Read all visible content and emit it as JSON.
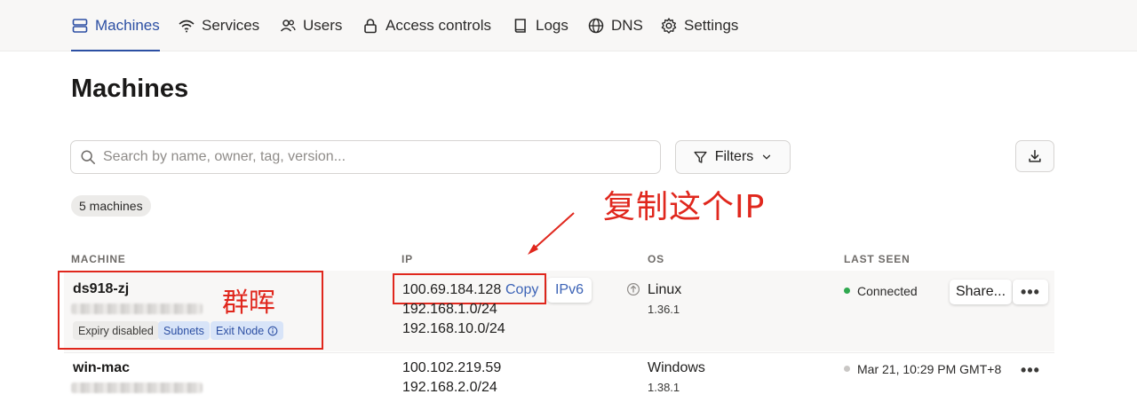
{
  "nav": {
    "items": [
      {
        "label": "Machines",
        "icon": "server-icon",
        "active": true
      },
      {
        "label": "Services",
        "icon": "wifi-icon"
      },
      {
        "label": "Users",
        "icon": "users-icon"
      },
      {
        "label": "Access controls",
        "icon": "lock-icon"
      },
      {
        "label": "Logs",
        "icon": "book-icon"
      },
      {
        "label": "DNS",
        "icon": "globe-icon"
      },
      {
        "label": "Settings",
        "icon": "gear-icon"
      }
    ]
  },
  "page": {
    "title": "Machines"
  },
  "search": {
    "placeholder": "Search by name, owner, tag, version..."
  },
  "filters": {
    "label": "Filters"
  },
  "count": {
    "label": "5 machines"
  },
  "annotations": {
    "copy_ip": "复制这个IP",
    "synology": "群晖",
    "color": "#e0271d"
  },
  "table": {
    "headers": {
      "machine": "MACHINE",
      "ip": "IP",
      "os": "OS",
      "last_seen": "LAST SEEN"
    },
    "rows": [
      {
        "name": "ds918-zj",
        "tags": [
          "Expiry disabled",
          "Subnets",
          "Exit Node"
        ],
        "ip_main": "100.69.184.128",
        "copy_label": "Copy",
        "ipv6_label": "IPv6",
        "subnets": [
          "192.168.1.0/24",
          "192.168.10.0/24"
        ],
        "os": "Linux",
        "os_version": "1.36.1",
        "last_seen": "Connected",
        "status_color": "#2fa84f",
        "share_label": "Share...",
        "more_label": "•••"
      },
      {
        "name": "win-mac",
        "ip_main": "100.102.219.59",
        "subnets": [
          "192.168.2.0/24"
        ],
        "os": "Windows",
        "os_version": "1.38.1",
        "last_seen": "Mar 21, 10:29 PM GMT+8",
        "status_color": "#c9c7c5",
        "more_label": "•••"
      }
    ]
  },
  "colors": {
    "accent": "#2c4fa3",
    "link": "#3c63b6"
  }
}
